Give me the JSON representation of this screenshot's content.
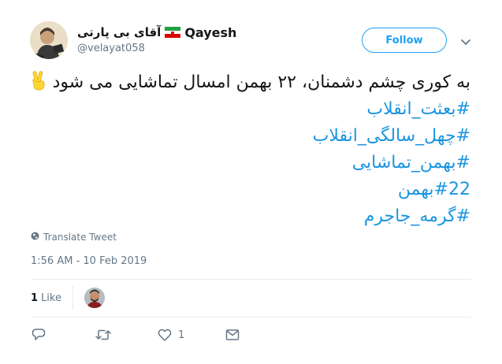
{
  "author": {
    "display_name_latin": "Qayesh",
    "display_name_persian": "آقای بی پارتی",
    "handle": "@velayat058",
    "flag_icon": "iran-flag-icon"
  },
  "follow_label": "Follow",
  "tweet": {
    "main_text": "به کوری چشم دشمنان، ۲۲ بهمن امسال تماشایی می شود",
    "hashtags": [
      "#بعثت_انقلاب",
      "#چهل_سالگی_انقلاب",
      "#بهمن_تماشایی",
      "#22بهمن",
      "#گرمه_جاجرم"
    ]
  },
  "translate_label": "Translate Tweet",
  "timestamp": "1:56 AM - 10 Feb 2019",
  "stats": {
    "likes_count": "1",
    "likes_label": "Like"
  },
  "actions": {
    "like_count": "1"
  },
  "colors": {
    "accent": "#1da1f2",
    "hashtag": "#1b95e0",
    "muted": "#657786"
  }
}
